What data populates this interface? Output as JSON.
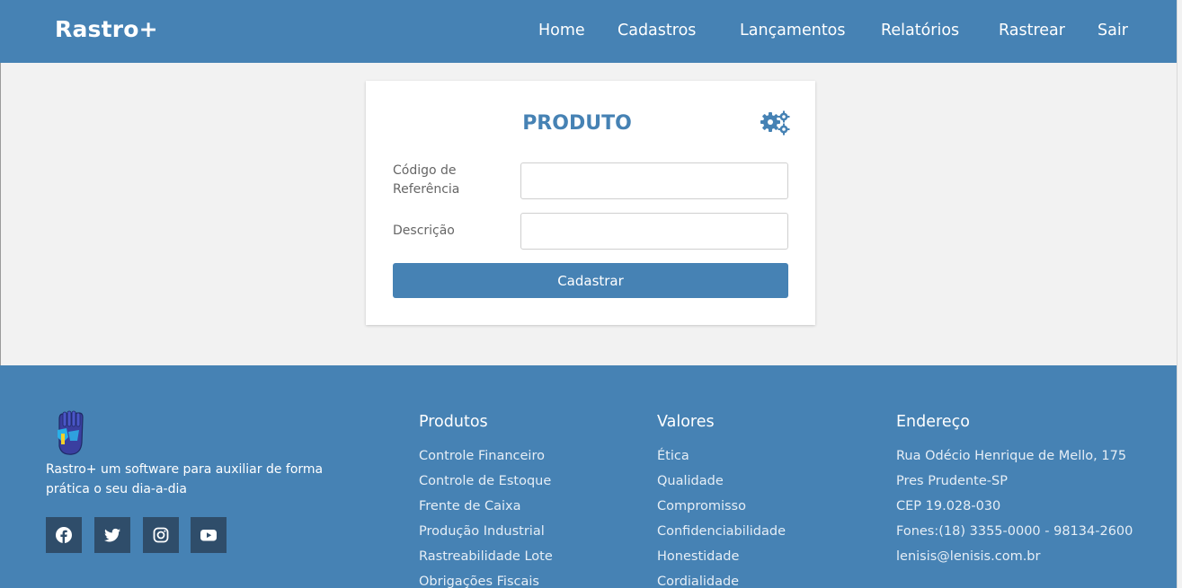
{
  "nav": {
    "brand": "Rastro+",
    "links": [
      "Home",
      "Cadastros",
      "Lançamentos",
      "Relatórios",
      "Rastrear",
      "Sair"
    ]
  },
  "form": {
    "title": "PRODUTO",
    "fields": [
      {
        "label_line1": "Código de",
        "label_line2": "Referência",
        "value": ""
      },
      {
        "label": "Descrição",
        "value": ""
      }
    ],
    "submit_label": "Cadastrar"
  },
  "footer": {
    "tagline": "Rastro+ um software para auxiliar de forma prática o seu dia-a-dia",
    "social": [
      "facebook-icon",
      "twitter-icon",
      "instagram-icon",
      "youtube-icon"
    ],
    "produtos": {
      "title": "Produtos",
      "items": [
        "Controle Financeiro",
        "Controle de Estoque",
        "Frente de Caixa",
        "Produção Industrial",
        "Rastreabilidade Lote",
        "Obrigações Fiscais"
      ]
    },
    "valores": {
      "title": "Valores",
      "items": [
        "Ética",
        "Qualidade",
        "Compromisso",
        "Confidenciabilidade",
        "Honestidade",
        "Cordialidade"
      ]
    },
    "endereco": {
      "title": "Endereço",
      "lines": [
        "Rua Odécio Henrique de Mello, 175",
        "Pres Prudente-SP",
        "CEP 19.028-030",
        "Fones:(18) 3355-0000 - 98134-2600",
        "lenisis@lenisis.com.br"
      ]
    }
  },
  "colors": {
    "primary": "#4682b4",
    "background": "#f2f2f2",
    "social_bg": "#2f4d6a"
  }
}
